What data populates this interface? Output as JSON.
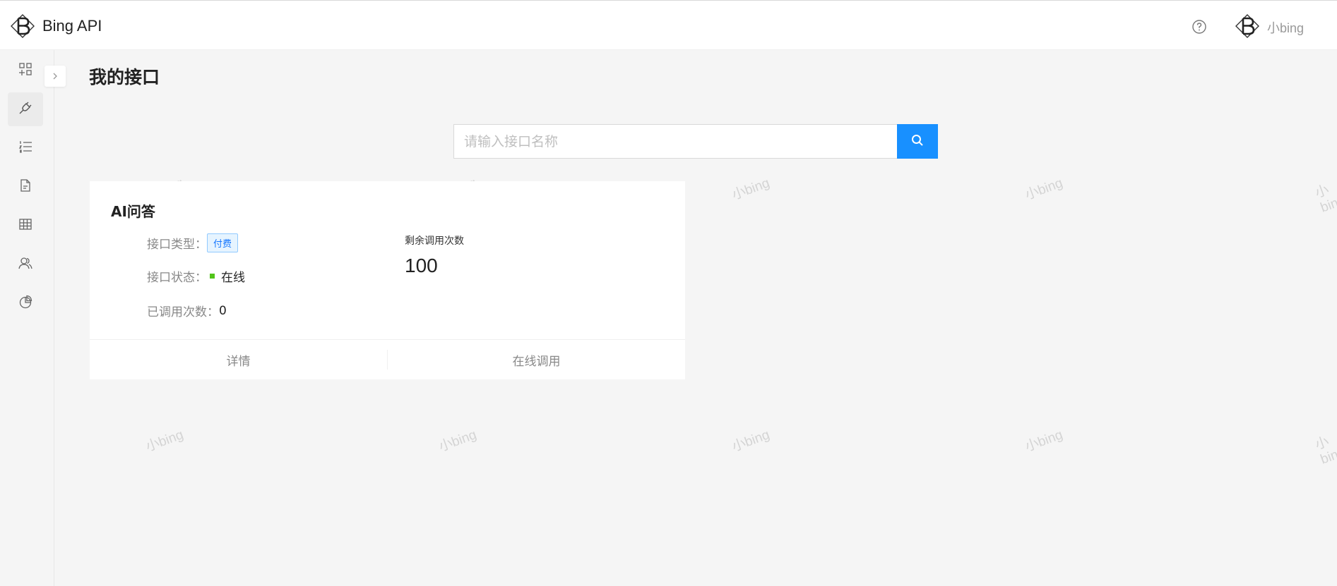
{
  "header": {
    "app_title": "Bing API",
    "user_name": "小bing"
  },
  "icons": {
    "logo": "bing-b-logo-icon",
    "help": "question-circle-icon",
    "collapse": "chevron-right-icon",
    "search": "search-icon"
  },
  "sidebar": {
    "items": [
      {
        "name": "dashboard",
        "icon": "apps-plus-icon",
        "active": false
      },
      {
        "name": "my-interfaces",
        "icon": "plug-icon",
        "active": true
      },
      {
        "name": "list",
        "icon": "ordered-list-icon",
        "active": false
      },
      {
        "name": "document",
        "icon": "file-icon",
        "active": false
      },
      {
        "name": "table",
        "icon": "table-icon",
        "active": false
      },
      {
        "name": "users",
        "icon": "user-group-icon",
        "active": false
      },
      {
        "name": "analysis",
        "icon": "pie-chart-icon",
        "active": false
      }
    ]
  },
  "main": {
    "page_title": "我的接口",
    "search": {
      "placeholder": "请输入接口名称",
      "value": ""
    }
  },
  "card": {
    "title": "AI问答",
    "type_label": "接口类型：",
    "type_tag": "付费",
    "status_label": "接口状态：",
    "status_value": "在线",
    "calls_label": "已调用次数：",
    "calls_value": "0",
    "remaining_label": "剩余调用次数",
    "remaining_value": "100",
    "detail_button": "详情",
    "online_call_button": "在线调用"
  },
  "watermark": "小bing",
  "colors": {
    "primary": "#1890ff",
    "status_online": "#52c41a",
    "tag_border": "#91caff",
    "tag_bg": "#e6f4ff",
    "background": "#f5f5f5"
  }
}
